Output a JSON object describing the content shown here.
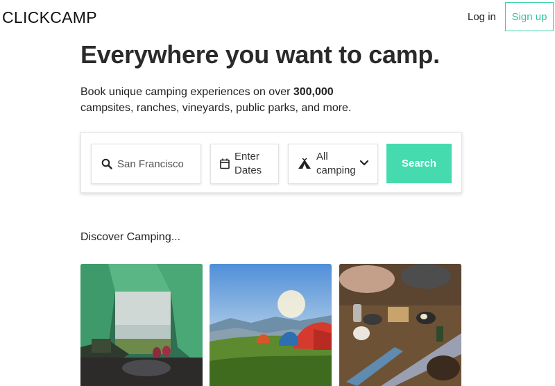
{
  "header": {
    "logo": "CLICKCAMP",
    "login_label": "Log in",
    "signup_label": "Sign up"
  },
  "hero": {
    "headline": "Everywhere you want to camp.",
    "subtext_prefix": "Book unique camping experiences on over ",
    "subtext_bold": "300,000",
    "subtext_suffix": " campsites, ranches, vineyards, public parks, and more."
  },
  "search": {
    "location_placeholder": "San Francisco",
    "location_value": "",
    "location_icon": "search-icon",
    "dates_label": "Enter Dates",
    "dates_icon": "calendar-icon",
    "type_label": "All camping",
    "type_icon": "tent-icon",
    "type_dropdown_icon": "chevron-down-icon",
    "button_label": "Search"
  },
  "discover": {
    "heading": "Discover Camping...",
    "cards": [
      {
        "image": "tent-interior-view-photo"
      },
      {
        "image": "tents-on-hill-sunset-photo"
      },
      {
        "image": "campers-cooking-outdoors-photo"
      }
    ]
  },
  "colors": {
    "accent": "#45dbae",
    "accent_text": "#2fc49c",
    "text": "#222222"
  }
}
